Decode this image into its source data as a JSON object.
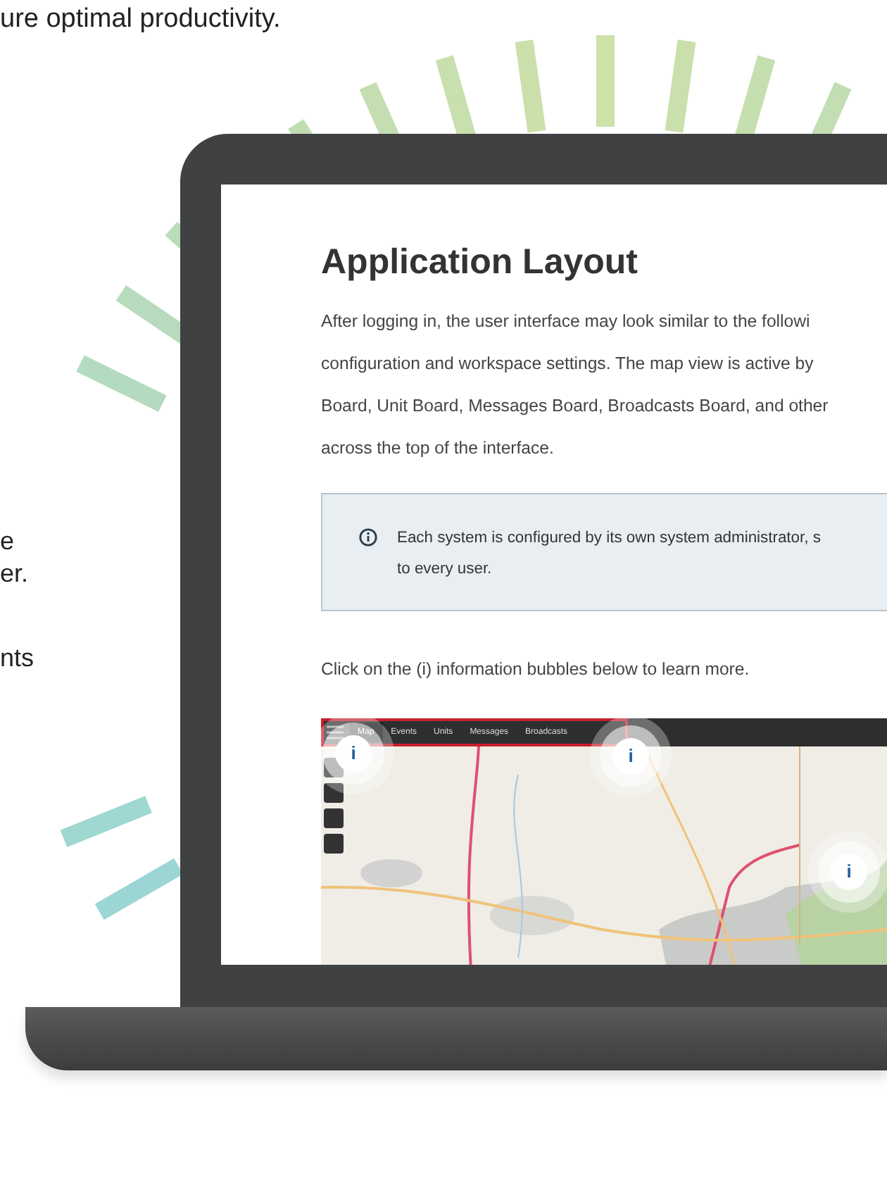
{
  "intro_fragment": "ure optimal productivity.",
  "side_fragments": [
    "e",
    "er.",
    "nts"
  ],
  "doc": {
    "title": "Application Layout",
    "paragraph_lines": [
      "After logging in, the user interface may look similar to the followi",
      "configuration and workspace settings. The map view is active by",
      "Board, Unit Board, Messages Board, Broadcasts Board, and other",
      "across the top of the interface."
    ],
    "callout_lines": [
      "Each system is configured by its own system administrator, s",
      "to every user."
    ],
    "instruction": "Click on the (i) information bubbles below to learn more."
  },
  "app_preview": {
    "tabs": [
      {
        "label": "Map",
        "selected": true
      },
      {
        "label": "Events",
        "selected": false
      },
      {
        "label": "Units",
        "selected": false
      },
      {
        "label": "Messages",
        "selected": false
      },
      {
        "label": "Broadcasts",
        "selected": false
      }
    ],
    "bubbles": [
      "i",
      "i",
      "i"
    ],
    "map": {
      "kind": "picture"
    }
  }
}
